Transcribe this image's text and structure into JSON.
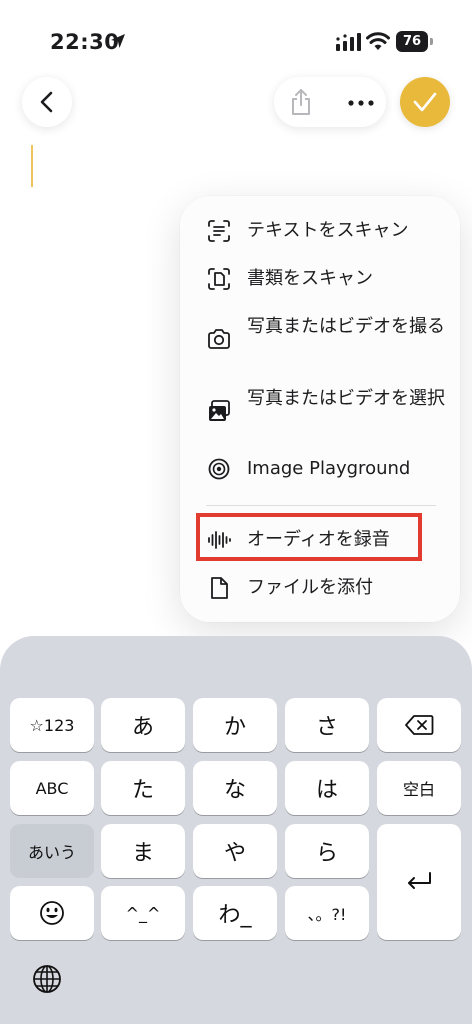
{
  "status_bar": {
    "time": "22:30",
    "battery_level": "76",
    "icons": [
      "location-arrow-icon",
      "signal-icon",
      "wifi-icon",
      "battery-icon"
    ]
  },
  "nav": {
    "icons": [
      "back-chevron-icon",
      "share-icon",
      "more-icon",
      "checkmark-icon"
    ],
    "accent_color": "#e9b93b"
  },
  "menu": {
    "items": [
      {
        "label": "テキストをスキャン",
        "icon": "scan-text-icon"
      },
      {
        "label": "書類をスキャン",
        "icon": "scan-document-icon"
      },
      {
        "label": "写真またはビデオを撮る",
        "icon": "camera-icon"
      },
      {
        "label": "写真またはビデオを選択",
        "icon": "photo-library-icon"
      },
      {
        "label": "Image Playground",
        "icon": "image-playground-icon"
      },
      {
        "label": "オーディオを録音",
        "icon": "waveform-icon"
      },
      {
        "label": "ファイルを添付",
        "icon": "document-icon"
      }
    ],
    "highlight_color": "#e23b2f"
  },
  "keyboard": {
    "keys": {
      "numbers": "☆123",
      "a": "あ",
      "ka": "か",
      "sa": "さ",
      "abc": "ABC",
      "ta": "た",
      "na": "な",
      "ha": "は",
      "space": "空白",
      "aiu": "あいう",
      "ma": "ま",
      "ya": "や",
      "ra": "ら",
      "kaomoji": "^_^",
      "wa": "わ_",
      "punct": "、。?!"
    },
    "icons": [
      "delete-icon",
      "return-icon",
      "emoji-icon",
      "globe-icon"
    ]
  }
}
